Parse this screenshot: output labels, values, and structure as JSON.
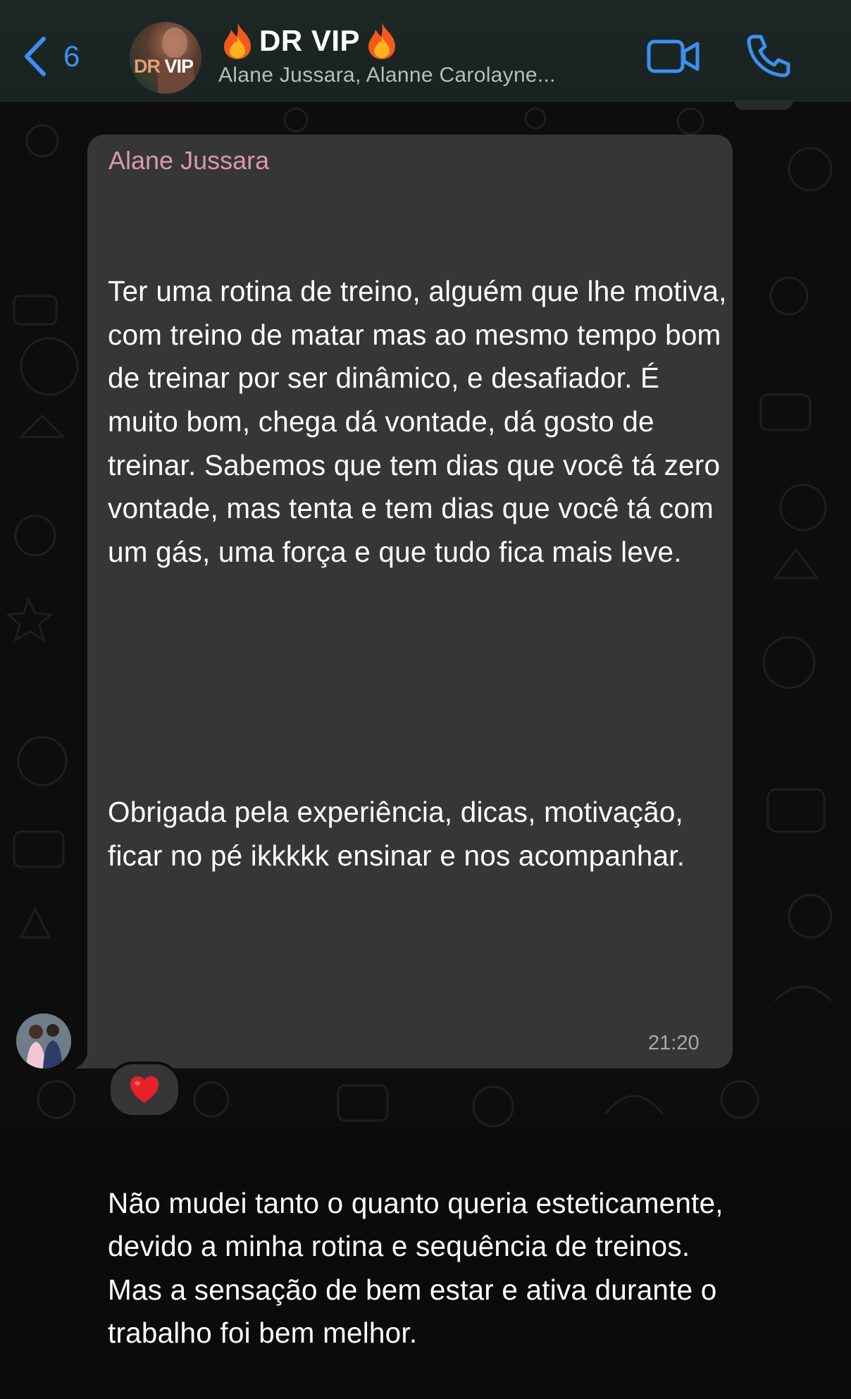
{
  "header": {
    "back_count": "6",
    "group_name": "DR VIP",
    "group_emoji": "fire",
    "members": "Alane Jussara, Alanne Carolayne...",
    "avatar_text_1": "DR",
    "avatar_text_2": "VIP"
  },
  "message": {
    "sender": "Alane Jussara",
    "paragraphs": [
      "Ter uma rotina de treino, alguém que lhe motiva, com treino de matar mas ao mesmo tempo bom de treinar por ser dinâmico, e desafiador. É muito bom, chega dá vontade, dá gosto de treinar. Sabemos que tem dias que você tá zero vontade, mas tenta e tem dias que você tá com um gás, uma força e que tudo fica mais leve.",
      "Obrigada pela experiência, dicas, motivação, ficar no pé ikkkkk ensinar e nos acompanhar.",
      "Não mudei tanto o quanto queria esteticamente, devido a minha rotina e sequência de treinos. Mas a sensação de bem estar e ativa durante o trabalho foi bem melhor."
    ],
    "time": "21:20",
    "reaction": "heart"
  },
  "colors": {
    "accent": "#3d8ff2",
    "sender_name": "#d898b0",
    "bubble": "#363638",
    "header_bg": "#1d2826"
  },
  "icons": {
    "back": "chevron-left-icon",
    "video": "video-camera-icon",
    "call": "phone-icon"
  }
}
